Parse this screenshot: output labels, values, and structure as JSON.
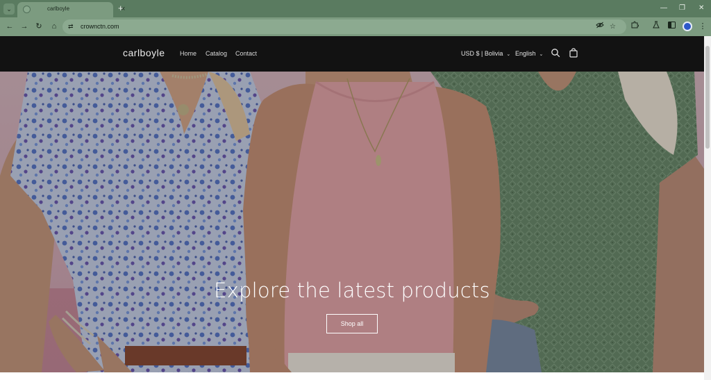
{
  "browser": {
    "tab_title": "carlboyle",
    "url": "crownctn.com",
    "tab_list_icon": "chevron-down-icon",
    "tab_close_icon": "close-icon",
    "new_tab_icon": "plus-icon",
    "window_controls": [
      "minimize-icon",
      "restore-icon",
      "close-icon"
    ],
    "toolbar_icons": [
      "back-arrow-icon",
      "forward-arrow-icon",
      "reload-icon",
      "home-icon"
    ],
    "omnibox_icons": [
      "site-info-icon",
      "eye-off-icon",
      "star-icon"
    ],
    "extension_icons": [
      "puzzle-icon",
      "labs-flask-icon",
      "side-panel-icon",
      "profile-avatar-icon",
      "kebab-menu-icon"
    ],
    "frame_color": "#5a7b60"
  },
  "site": {
    "logo": "carlboyle",
    "nav": [
      {
        "label": "Home"
      },
      {
        "label": "Catalog"
      },
      {
        "label": "Contact"
      }
    ],
    "currency": "USD $ | Bolivia",
    "language": "English",
    "search_icon": "search-icon",
    "cart_icon": "cart-bag-icon",
    "header_bg": "#121212"
  },
  "hero": {
    "heading": "Explore the latest products",
    "button_label": "Shop all",
    "accent_pink": "#e6a7ab",
    "accent_green": "#6f8d6e"
  }
}
